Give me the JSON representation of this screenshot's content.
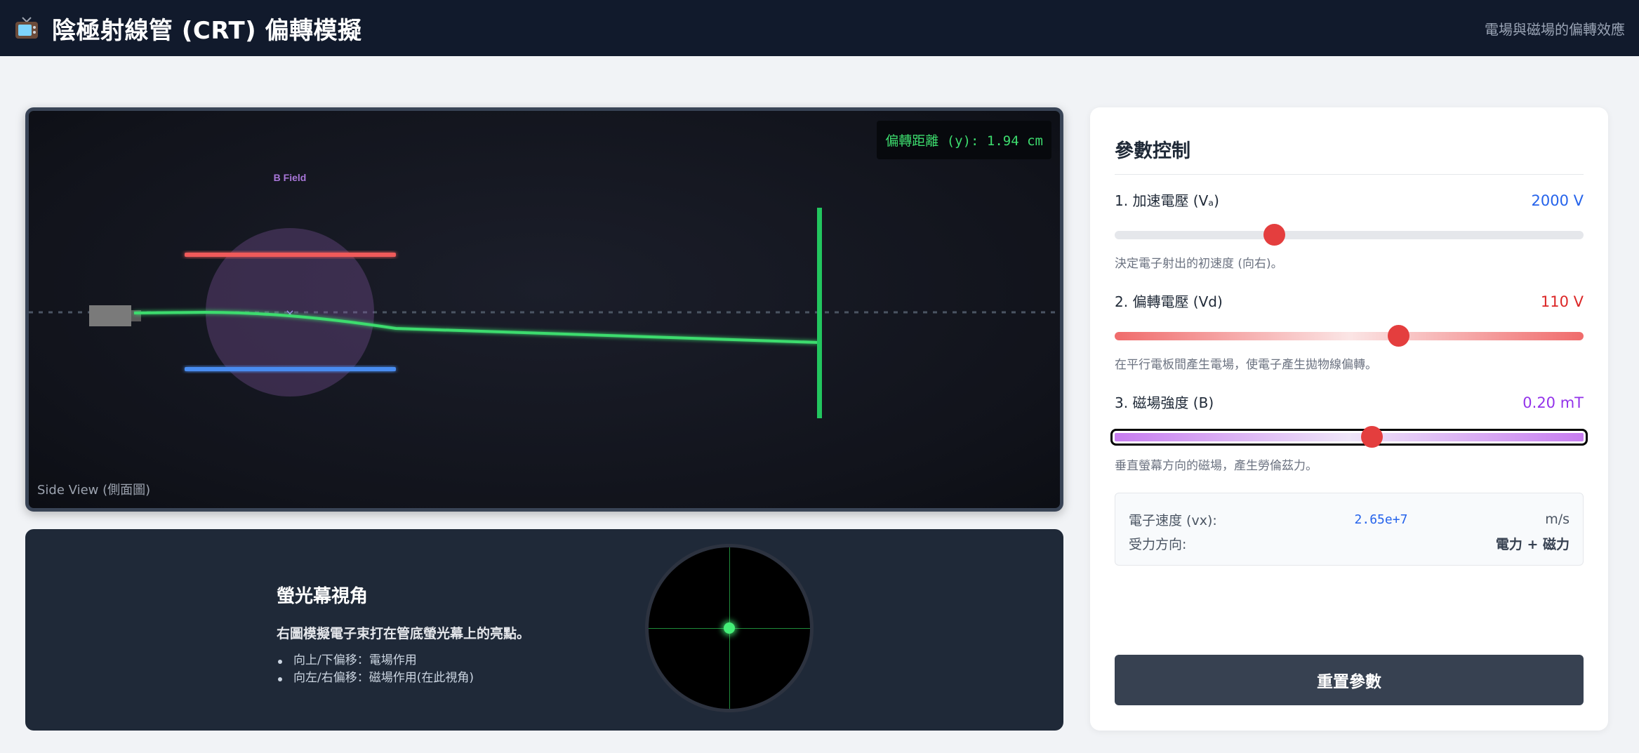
{
  "header": {
    "title": "陰極射線管 (CRT) 偏轉模擬",
    "subtitle": "電場與磁場的偏轉效應",
    "icon": "tv-icon"
  },
  "side_view": {
    "deflection_readout": "偏轉距離 (y): 1.94 cm",
    "b_field_label": "B Field",
    "view_label": "Side View (側面圖)",
    "colors": {
      "upper_plate": "#f05a5a",
      "lower_plate": "#4a8cf0",
      "beam": "#3ddc6e",
      "field": "#8a5aa8"
    }
  },
  "screen_view": {
    "title": "螢光幕視角",
    "description": "右圖模擬電子束打在管底螢光幕上的亮點。",
    "bullets": [
      "向上/下偏移：電場作用",
      "向左/右偏移：磁場作用(在此視角)"
    ]
  },
  "controls": {
    "title": "參數控制",
    "accel": {
      "label": "1. 加速電壓 (Vₐ)",
      "value": "2000 V",
      "hint": "決定電子射出的初速度 (向右)。",
      "fraction": 0.34,
      "color": "#2563eb"
    },
    "deflect": {
      "label": "2. 偏轉電壓 (Vd)",
      "value": "110 V",
      "hint": "在平行電板間產生電場，使電子產生拋物線偏轉。",
      "fraction": 0.605,
      "color": "#dc2626"
    },
    "bfield": {
      "label": "3. 磁場強度 (B)",
      "value": "0.20 mT",
      "hint": "垂直螢幕方向的磁場，產生勞倫茲力。",
      "fraction": 0.548,
      "color": "#9333ea"
    },
    "info": {
      "speed_label": "電子速度 (vx):",
      "speed_value": "2.65e+7",
      "speed_unit": "m/s",
      "force_label": "受力方向:",
      "force_value": "電力 + 磁力"
    },
    "reset_label": "重置參數"
  }
}
